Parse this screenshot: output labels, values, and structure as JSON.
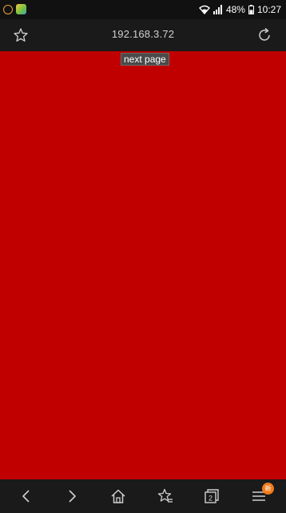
{
  "status_bar": {
    "battery": "48%",
    "time": "10:27"
  },
  "toolbar": {
    "address": "192.168.3.72",
    "icons": {
      "left": "star-icon",
      "right": "reload-icon"
    }
  },
  "content": {
    "background_color": "#c00000",
    "next_page_label": "next page"
  },
  "bottom_nav": {
    "items": [
      "back-icon",
      "forward-icon",
      "home-icon",
      "favorites-icon",
      "tabs-icon",
      "menu-icon"
    ],
    "tabs_count": "2",
    "menu_badge": "新"
  }
}
